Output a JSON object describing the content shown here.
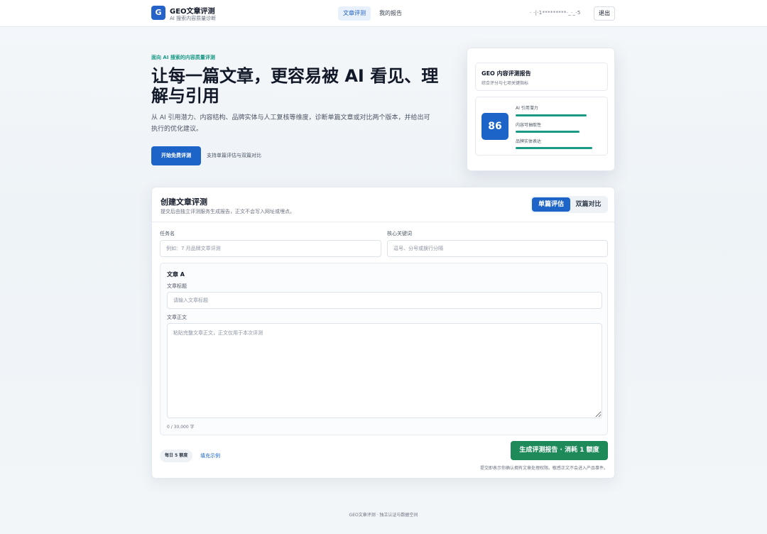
{
  "header": {
    "logo_letter": "G",
    "brand_name": "GEO文章评测",
    "brand_sub": "AI 搜索内容质量诊断",
    "nav": [
      "文章评测",
      "我的报告"
    ],
    "user_id": "·  ·|·1*********·_·_·5",
    "logout": "退出"
  },
  "hero": {
    "eyebrow": "面向 AI 搜索的内容质量评测",
    "title": "让每一篇文章，更容易被 AI 看见、理解与引用",
    "description": "从 AI 引用潜力、内容结构、品牌实体与人工复核等维度，诊断单篇文章或对比两个版本，并给出可执行的优化建议。",
    "cta": "开始免费评测",
    "cta_note": "支持单篇评估与双篇对比"
  },
  "preview": {
    "title": "GEO 内容评测报告",
    "subtitle": "综合评分与七项关键指标",
    "score": "86",
    "metrics": [
      {
        "label": "AI 引用潜力",
        "value": 0.86
      },
      {
        "label": "内容可抽取性",
        "value": 0.78
      },
      {
        "label": "品牌实体表达",
        "value": 0.93
      }
    ]
  },
  "form": {
    "title": "创建文章评测",
    "subtitle": "提交后由独立评测服务生成报告，正文不会写入网址或埋点。",
    "modes": [
      "单篇评估",
      "双篇对比"
    ],
    "task_label": "任务名",
    "task_placeholder": "例如：7 月品牌文章评测",
    "keyword_label": "核心关键词",
    "keyword_placeholder": "逗号、分号或换行分隔",
    "article_heading": "文章 A",
    "article_title_label": "文章标题",
    "article_title_placeholder": "请输入文章标题",
    "article_body_label": "文章正文",
    "article_body_placeholder": "粘贴完整文章正文，正文仅用于本次评测",
    "char_count": "0 / 30,000 字",
    "quota": "每日 5 额度",
    "fill_example": "填充示例",
    "submit": "生成评测报告 · 消耗 1 额度",
    "submit_note": "提交即表示你确认拥有文章处理权限。敏感正文不会进入产品事件。"
  },
  "footer": "GEO文章评测 · 独立认证与数据空间",
  "colors": {
    "primary": "#1d64c8",
    "teal": "#1a9a86",
    "green": "#1e8a5a"
  }
}
